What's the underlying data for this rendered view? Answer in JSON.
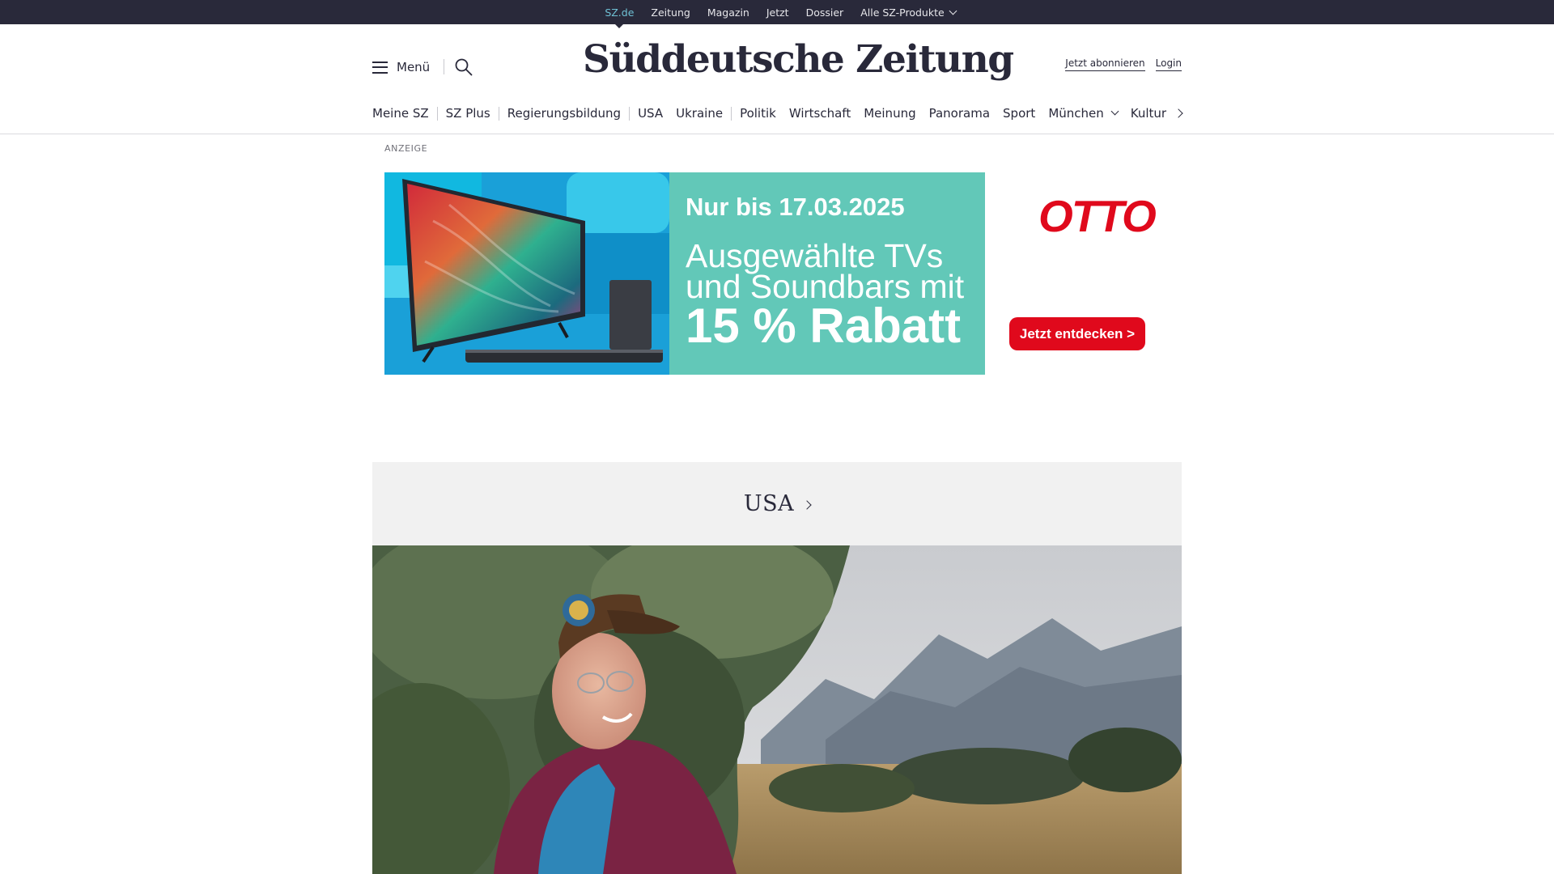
{
  "topbar": {
    "links": [
      "SZ.de",
      "Zeitung",
      "Magazin",
      "Jetzt",
      "Dossier"
    ],
    "products_label": "Alle SZ-Produkte"
  },
  "masthead": {
    "menu_label": "Menü",
    "logo_text": "Süddeutsche Zeitung",
    "subscribe_label": "Jetzt abonnieren",
    "login_label": "Login"
  },
  "section_nav": {
    "items": [
      "Meine SZ",
      "SZ Plus",
      "Regierungsbildung",
      "USA",
      "Ukraine",
      "Politik",
      "Wirtschaft",
      "Meinung",
      "Panorama",
      "Sport",
      "München",
      "Kultur"
    ]
  },
  "ad": {
    "label": "ANZEIGE",
    "date_line": "Nur bis 17.03.2025",
    "line1": "Ausgewählte TVs",
    "line2": "und Soundbars mit",
    "discount": "15 % Rabatt",
    "brand": "OTTO",
    "cta": "Jetzt entdecken >",
    "colors": {
      "teal": "#62c8b8",
      "blue": "#1aa0d8",
      "otto_red": "#e0091c"
    }
  },
  "section_teaser": {
    "title": "USA"
  },
  "colors": {
    "topbar_bg": "#29293a",
    "active_link": "#6fc1d5",
    "text": "#29293a"
  }
}
